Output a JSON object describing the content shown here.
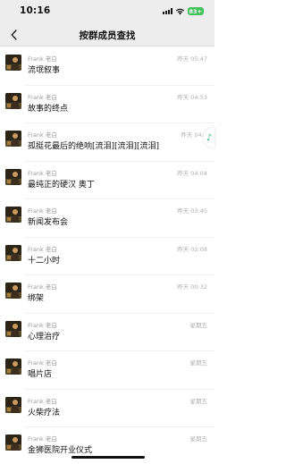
{
  "status_bar": {
    "time": "10:16",
    "battery": "83+"
  },
  "header": {
    "title": "按群成员查找"
  },
  "messages": [
    {
      "sender": "Frank 老白",
      "time": "昨天 05:47",
      "text": "流氓叙事"
    },
    {
      "sender": "Frank 老白",
      "time": "昨天 04:53",
      "text": "故事的终点"
    },
    {
      "sender": "Frank 老白",
      "time": "昨天 04:1",
      "text": "孤挺花最后的绝响[流泪][流泪][流泪]"
    },
    {
      "sender": "Frank 老白",
      "time": "昨天 04:04",
      "text": "最纯正的硬汉 奥丁"
    },
    {
      "sender": "Frank 老白",
      "time": "昨天 03:45",
      "text": "新闻发布会"
    },
    {
      "sender": "Frank 老白",
      "time": "昨天 02:08",
      "text": "十二小时"
    },
    {
      "sender": "Frank 老白",
      "time": "昨天 00:32",
      "text": "绑架"
    },
    {
      "sender": "Frank 老白",
      "time": "星期五",
      "text": "心理治疗"
    },
    {
      "sender": "Frank 老白",
      "time": "星期五",
      "text": "唱片店"
    },
    {
      "sender": "Frank 老白",
      "time": "星期五",
      "text": "火柴疗法"
    },
    {
      "sender": "Frank 老白",
      "time": "星期五",
      "text": "金狮医院开业仪式"
    }
  ],
  "icons": {
    "back": "chevron-left-icon",
    "signal": "signal-icon",
    "wifi": "wifi-icon",
    "battery": "battery-icon",
    "float": "music-note-icon"
  },
  "colors": {
    "bar_bg": "#ededed",
    "battery": "#43c15a",
    "accent": "#1fb96a"
  }
}
